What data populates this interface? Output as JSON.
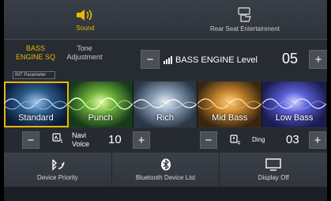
{
  "top_tabs": {
    "sound": {
      "label": "Sound",
      "icon": "speaker-sound-icon",
      "selected": true,
      "color": "#e9b800"
    },
    "rse": {
      "label": "Rear Seat Entertainment",
      "icon": "rear-seat-entertainment-icon",
      "selected": false
    }
  },
  "settings": {
    "bass_engine_tab": "BASS ENGINE SQ",
    "tone_tab": "Tone Adjustment",
    "int_parameter": "INT Parameter",
    "bass_engine_level_label": "BASS ENGINE Level",
    "bass_engine_level_value": "05"
  },
  "presets": [
    {
      "label": "Standard",
      "selected": true
    },
    {
      "label": "Punch",
      "selected": false
    },
    {
      "label": "Rich",
      "selected": false
    },
    {
      "label": "Mid Bass",
      "selected": false
    },
    {
      "label": "Low Bass",
      "selected": false
    }
  ],
  "navi_voice": {
    "label": "Navi Voice",
    "value": "10",
    "icon": "navi-voice-icon"
  },
  "ding": {
    "label": "Ding",
    "value": "03",
    "icon": "ding-icon"
  },
  "actions": [
    {
      "label": "Device Priority",
      "icon": "device-priority-icon"
    },
    {
      "label": "Bluetooth Device List",
      "icon": "bluetooth-icon"
    },
    {
      "label": "Display Off",
      "icon": "display-off-icon"
    }
  ],
  "colors": {
    "accent": "#e9b800",
    "background": "#2b3038"
  }
}
